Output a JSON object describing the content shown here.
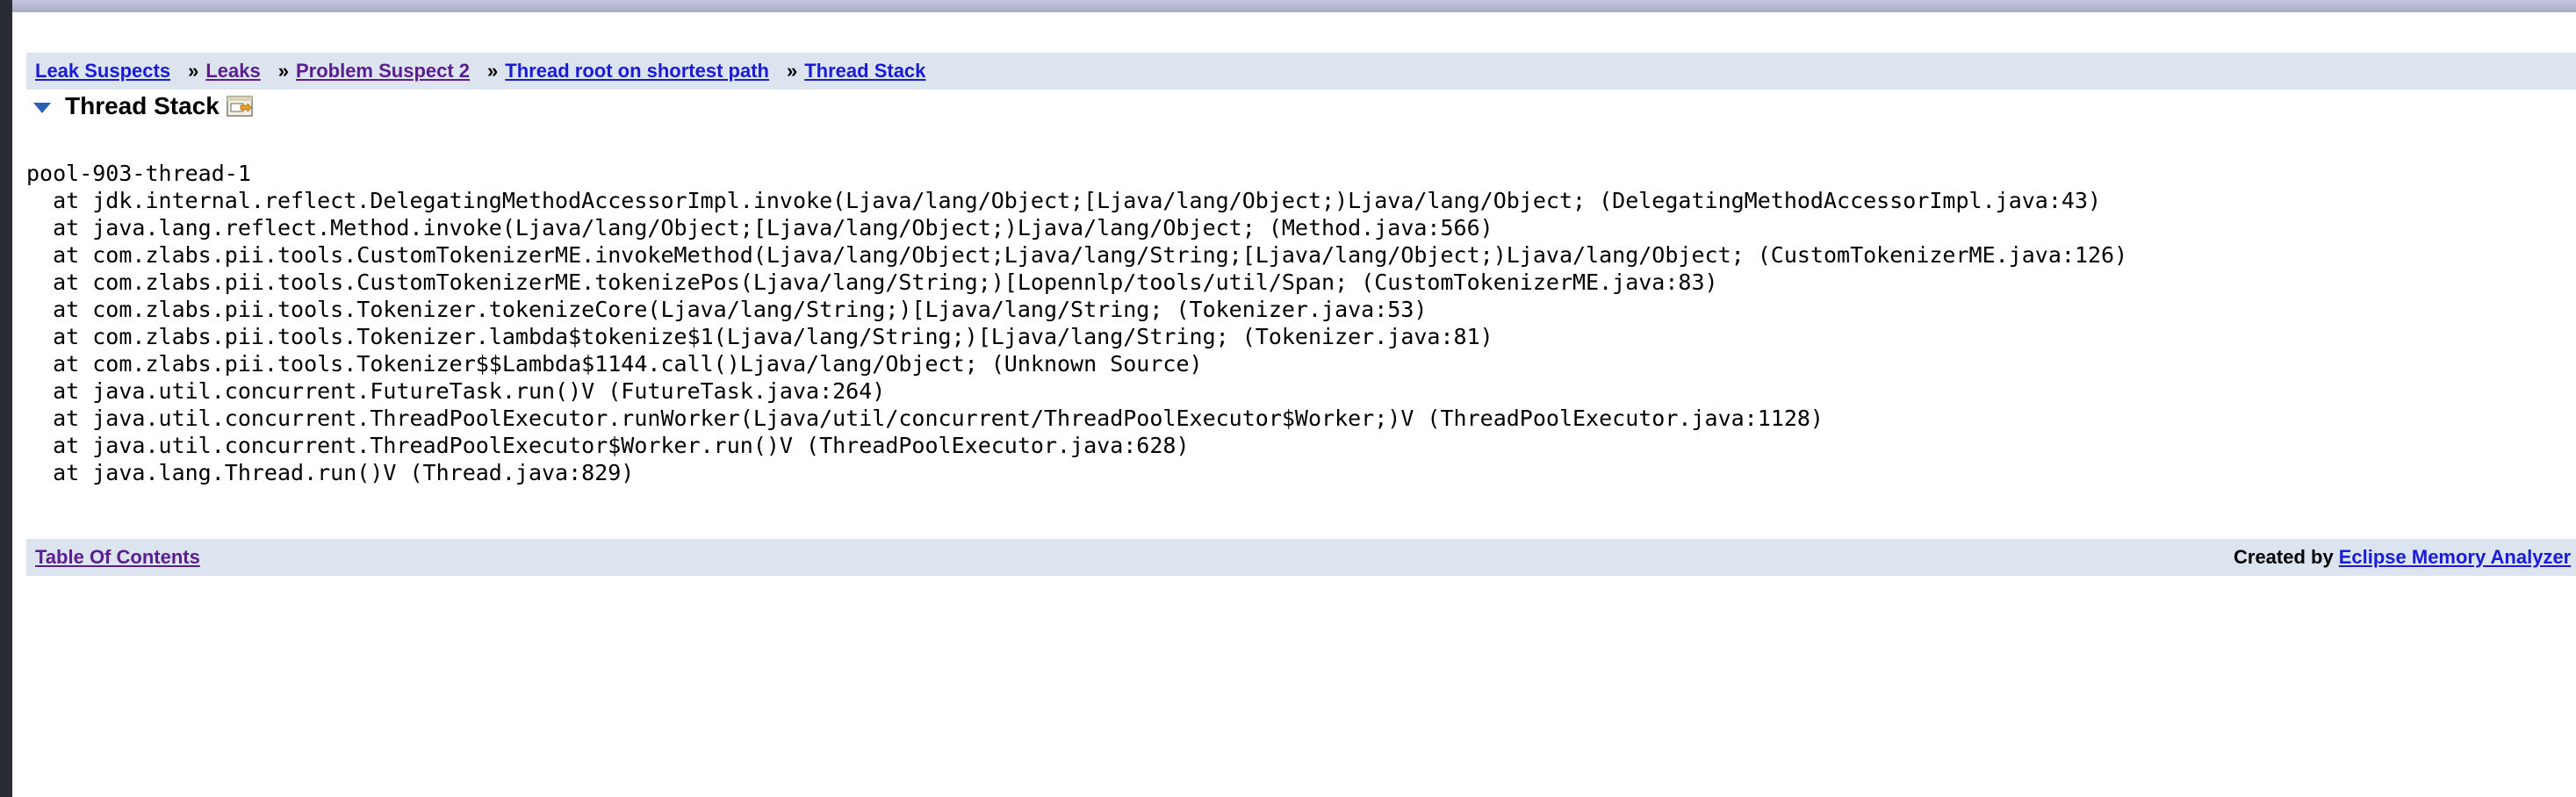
{
  "breadcrumbs": [
    {
      "label": "Leak Suspects",
      "visited": false
    },
    {
      "label": "Leaks",
      "visited": true
    },
    {
      "label": "Problem Suspect 2",
      "visited": true
    },
    {
      "label": "Thread root on shortest path",
      "visited": false
    },
    {
      "label": "Thread Stack",
      "visited": false
    }
  ],
  "breadcrumb_separator": "»",
  "section": {
    "title": "Thread Stack",
    "icon": "rename-icon"
  },
  "stack": {
    "thread_name": "pool-903-thread-1",
    "frames": [
      "  at jdk.internal.reflect.DelegatingMethodAccessorImpl.invoke(Ljava/lang/Object;[Ljava/lang/Object;)Ljava/lang/Object; (DelegatingMethodAccessorImpl.java:43)",
      "  at java.lang.reflect.Method.invoke(Ljava/lang/Object;[Ljava/lang/Object;)Ljava/lang/Object; (Method.java:566)",
      "  at com.zlabs.pii.tools.CustomTokenizerME.invokeMethod(Ljava/lang/Object;Ljava/lang/String;[Ljava/lang/Object;)Ljava/lang/Object; (CustomTokenizerME.java:126)",
      "  at com.zlabs.pii.tools.CustomTokenizerME.tokenizePos(Ljava/lang/String;)[Lopennlp/tools/util/Span; (CustomTokenizerME.java:83)",
      "  at com.zlabs.pii.tools.Tokenizer.tokenizeCore(Ljava/lang/String;)[Ljava/lang/String; (Tokenizer.java:53)",
      "  at com.zlabs.pii.tools.Tokenizer.lambda$tokenize$1(Ljava/lang/String;)[Ljava/lang/String; (Tokenizer.java:81)",
      "  at com.zlabs.pii.tools.Tokenizer$$Lambda$1144.call()Ljava/lang/Object; (Unknown Source)",
      "  at java.util.concurrent.FutureTask.run()V (FutureTask.java:264)",
      "  at java.util.concurrent.ThreadPoolExecutor.runWorker(Ljava/util/concurrent/ThreadPoolExecutor$Worker;)V (ThreadPoolExecutor.java:1128)",
      "  at java.util.concurrent.ThreadPoolExecutor$Worker.run()V (ThreadPoolExecutor.java:628)",
      "  at java.lang.Thread.run()V (Thread.java:829)"
    ]
  },
  "footer": {
    "toc_label": "Table Of Contents",
    "created_by_label": "Created by",
    "tool_link": "Eclipse Memory Analyzer"
  },
  "colors": {
    "bar_background": "#dce5ef",
    "link": "#1a1ad8",
    "visited_link": "#5a1e8e"
  }
}
